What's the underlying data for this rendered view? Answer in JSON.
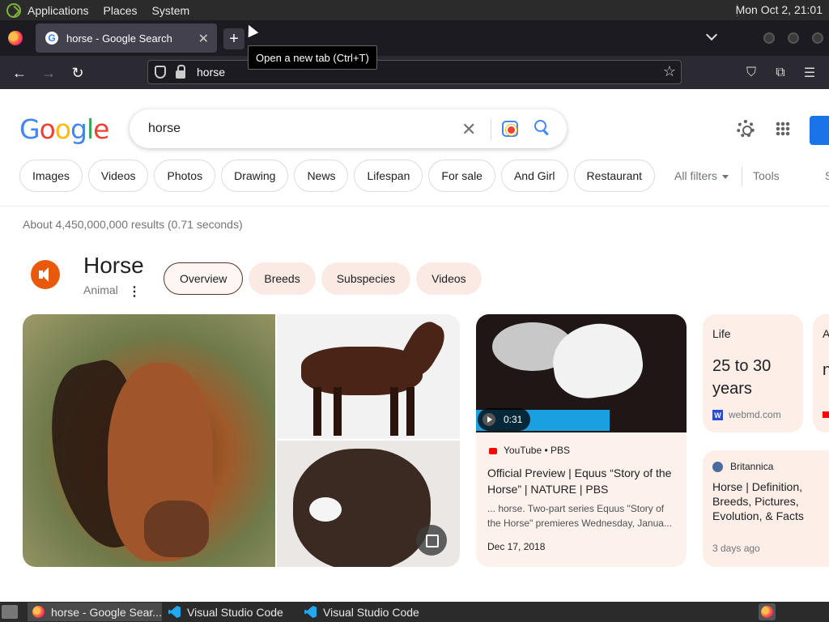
{
  "os": {
    "menus": [
      "Applications",
      "Places",
      "System"
    ],
    "clock": "Mon Oct  2, 21:01"
  },
  "browser": {
    "tab_title": "horse - Google Search",
    "tooltip": "Open a new tab (Ctrl+T)",
    "url": "horse"
  },
  "google": {
    "logo": [
      "G",
      "o",
      "o",
      "g",
      "l",
      "e"
    ],
    "query": "horse",
    "chips": [
      "Images",
      "Videos",
      "Photos",
      "Drawing",
      "News",
      "Lifespan",
      "For sale",
      "And Girl",
      "Restaurant"
    ],
    "all_filters": "All filters",
    "tools": "Tools",
    "cut_chip": "S",
    "stats": "About 4,450,000,000 results (0.71 seconds)"
  },
  "knowledge": {
    "title": "Horse",
    "subtitle": "Animal",
    "tabs": [
      "Overview",
      "Breeds",
      "Subspecies",
      "Videos"
    ],
    "video": {
      "duration": "0:31",
      "source": "YouTube • PBS",
      "title": "Official Preview | Equus “Story of the Horse” | NATURE | PBS",
      "snippet": "... horse. Two-part series Equus \"Story of the Horse\" premieres Wednesday, Janua...",
      "date": "Dec 17, 2018"
    },
    "life": {
      "label": "Life",
      "value": "25 to 30 years",
      "source": "webmd.com"
    },
    "cut_card": {
      "label": "A",
      "value": "n"
    },
    "britannica": {
      "source": "Britannica",
      "title": "Horse | Definition, Breeds, Pictures, Evolution, & Facts",
      "date": "3 days ago"
    }
  },
  "taskbar": {
    "tasks": [
      "horse - Google Sear...",
      "Visual Studio Code",
      "Visual Studio Code"
    ]
  },
  "colors": {
    "accent_blue": "#1a73e8",
    "kp_chip": "#fbe9e4",
    "speaker_orange": "#e8590c"
  }
}
